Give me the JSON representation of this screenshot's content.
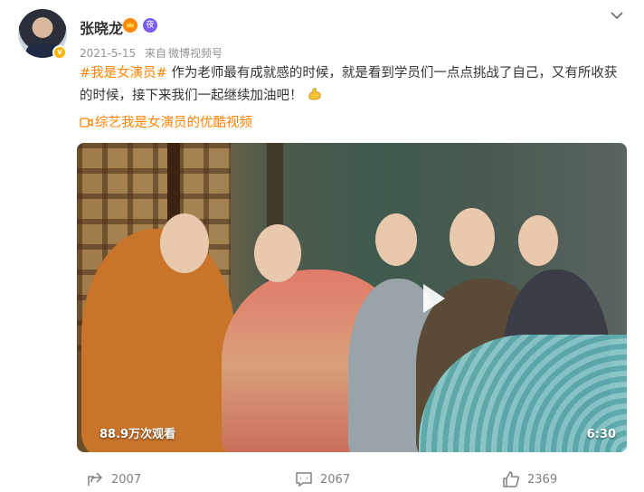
{
  "post": {
    "username": "张晓龙",
    "date": "2021-5-15",
    "source_prefix": "来自",
    "source": "微博视频号",
    "topic": "#我是女演员#",
    "text": " 作为老师最有成就感的时候，就是看到学员们一点点挑战了自己，又有所收获的时候，接下来我们一起继续加油吧！",
    "video_link_text": "综艺我是女演员的优酷视频"
  },
  "video": {
    "views": "88.9万次观看",
    "duration": "6:30"
  },
  "actions": {
    "share_count": "2007",
    "comment_count": "2067",
    "like_count": "2369"
  },
  "colors": {
    "accent": "#ff8200",
    "meta": "#939393",
    "text": "#333333"
  },
  "icons": [
    "avatar",
    "verified-badge",
    "crown-badge",
    "level-badge",
    "chevron-down-icon",
    "flexed-biceps-emoji",
    "video-link-icon",
    "play-icon",
    "share-icon",
    "comment-icon",
    "like-icon"
  ]
}
